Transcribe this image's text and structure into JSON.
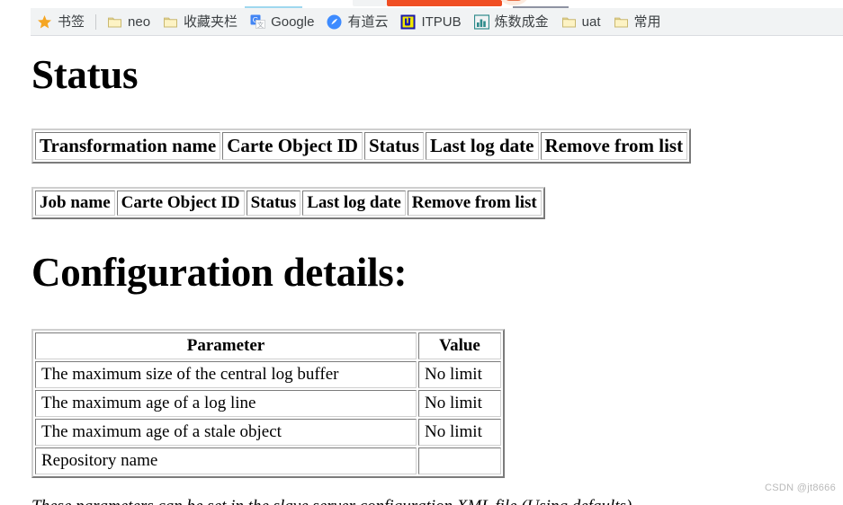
{
  "browser": {
    "bookmarks_bar": {
      "items": [
        {
          "label": "书签",
          "icon": "star-icon",
          "icon_color": "#f5a623"
        },
        {
          "separator": true
        },
        {
          "label": "neo",
          "icon": "folder-icon",
          "icon_color": "#fdf3c4"
        },
        {
          "label": "收藏夹栏",
          "icon": "folder-icon",
          "icon_color": "#fdf3c4"
        },
        {
          "label": "Google",
          "icon": "google-translate-icon",
          "icon_color": "#4285f4"
        },
        {
          "label": "有道云",
          "icon": "youdao-cloud-icon",
          "icon_color": "#3d8bff"
        },
        {
          "label": "ITPUB",
          "icon": "itpub-icon",
          "icon_color": "#1a1aa8"
        },
        {
          "label": "炼数成金",
          "icon": "bar-chart-icon",
          "icon_color": "#2e8b8b"
        },
        {
          "label": "uat",
          "icon": "folder-icon",
          "icon_color": "#fdf3c4"
        },
        {
          "label": "常用",
          "icon": "folder-icon",
          "icon_color": "#fdf3c4"
        }
      ]
    }
  },
  "page": {
    "status_heading": "Status",
    "config_heading": "Configuration details:",
    "transformation_table": {
      "headers": [
        "Transformation name",
        "Carte Object ID",
        "Status",
        "Last log date",
        "Remove from list"
      ],
      "rows": []
    },
    "job_table": {
      "headers": [
        "Job name",
        "Carte Object ID",
        "Status",
        "Last log date",
        "Remove from list"
      ],
      "rows": []
    },
    "config_table": {
      "headers": [
        "Parameter",
        "Value"
      ],
      "rows": [
        {
          "parameter": "The maximum size of the central log buffer",
          "value": "No limit"
        },
        {
          "parameter": "The maximum age of a log line",
          "value": "No limit"
        },
        {
          "parameter": "The maximum age of a stale object",
          "value": "No limit"
        },
        {
          "parameter": "Repository name",
          "value": ""
        }
      ]
    },
    "footnote": "These parameters can be set in the slave server configuration XML file (Using defaults)",
    "watermark": "CSDN @jt8666"
  }
}
